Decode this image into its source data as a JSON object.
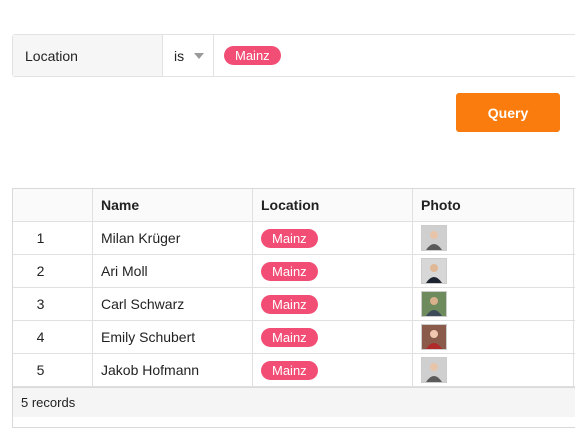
{
  "filter": {
    "field": "Location",
    "operator": "is",
    "value": "Mainz"
  },
  "query_button": "Query",
  "table": {
    "columns": [
      "Name",
      "Location",
      "Photo"
    ],
    "rows": [
      {
        "index": "1",
        "name": "Milan Krüger",
        "location": "Mainz",
        "photo_bg": "#cfcfcf",
        "photo_fg": "#5a5a5a"
      },
      {
        "index": "2",
        "name": "Ari Moll",
        "location": "Mainz",
        "photo_bg": "#d7d7d7",
        "photo_fg": "#1c2430"
      },
      {
        "index": "3",
        "name": "Carl Schwarz",
        "location": "Mainz",
        "photo_bg": "#6e8b5e",
        "photo_fg": "#3c4a5a"
      },
      {
        "index": "4",
        "name": "Emily Schubert",
        "location": "Mainz",
        "photo_bg": "#8a5a4a",
        "photo_fg": "#b02a2a"
      },
      {
        "index": "5",
        "name": "Jakob Hofmann",
        "location": "Mainz",
        "photo_bg": "#cfcfcf",
        "photo_fg": "#5a5a5a"
      }
    ],
    "footer": "5 records"
  },
  "colors": {
    "tag": "#f24e75",
    "query_button": "#fb7c0e"
  }
}
